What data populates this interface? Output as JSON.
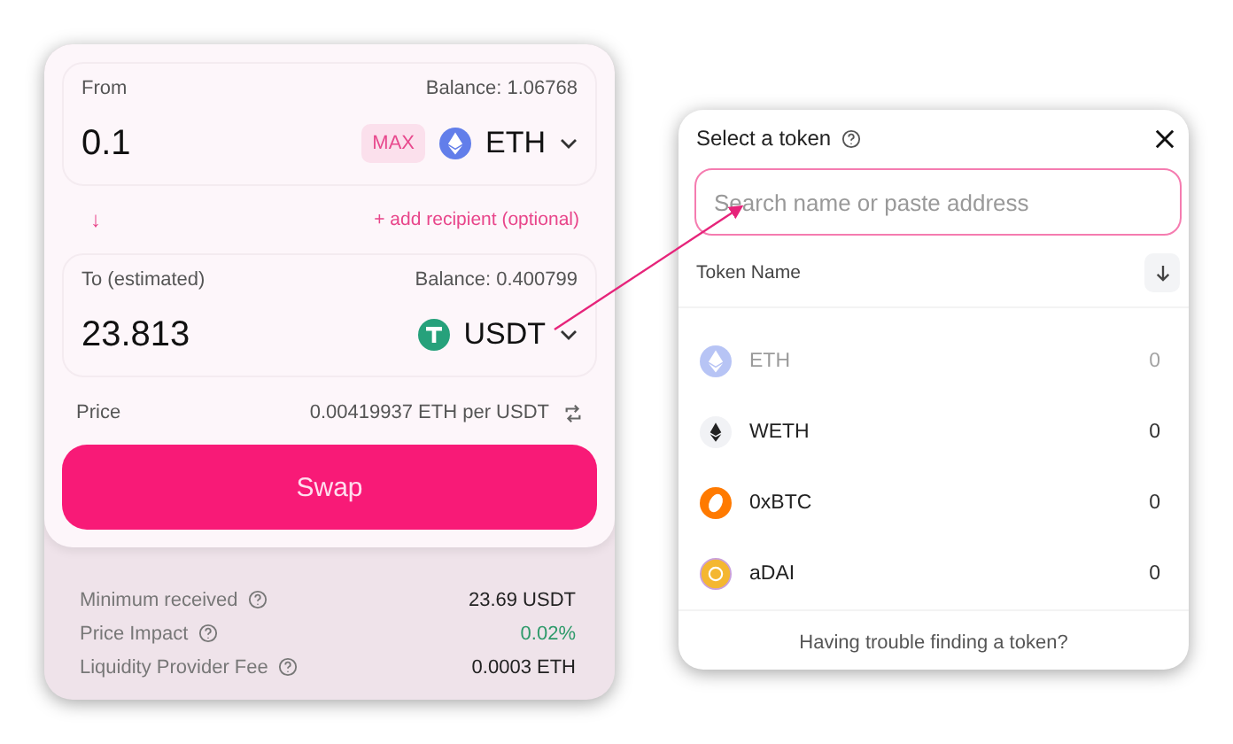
{
  "swap_card": {
    "from": {
      "label": "From",
      "balance": "Balance: 1.06768",
      "amount": "0.1",
      "max_button": "MAX",
      "token": "ETH",
      "kind": "eth"
    },
    "switch_icon": "↓",
    "add_recipient": "+ add recipient (optional)",
    "to": {
      "label": "To (estimated)",
      "balance": "Balance: 0.400799",
      "amount": "23.813",
      "token": "USDT",
      "kind": "usdt"
    },
    "price": {
      "label": "Price",
      "value": "0.00419937 ETH per USDT"
    },
    "swap_button": "Swap",
    "details": [
      {
        "label": "Minimum received",
        "value": "23.69 USDT",
        "kind": "plain"
      },
      {
        "label": "Price Impact",
        "value": "0.02%",
        "kind": "positive"
      },
      {
        "label": "Liquidity Provider Fee",
        "value": "0.0003 ETH",
        "kind": "plain"
      }
    ]
  },
  "token_modal": {
    "title": "Select a token",
    "search": {
      "placeholder": "Search name or paste address"
    },
    "column_header": "Token Name",
    "tokens": [
      {
        "symbol": "ETH",
        "balance": "0",
        "kind": "eth",
        "disabled": true
      },
      {
        "symbol": "WETH",
        "balance": "0",
        "kind": "weth",
        "disabled": false
      },
      {
        "symbol": "0xBTC",
        "balance": "0",
        "kind": "oxbtc",
        "disabled": false
      },
      {
        "symbol": "aDAI",
        "balance": "0",
        "kind": "adai",
        "disabled": false
      }
    ],
    "footer": "Having trouble finding a token?"
  }
}
